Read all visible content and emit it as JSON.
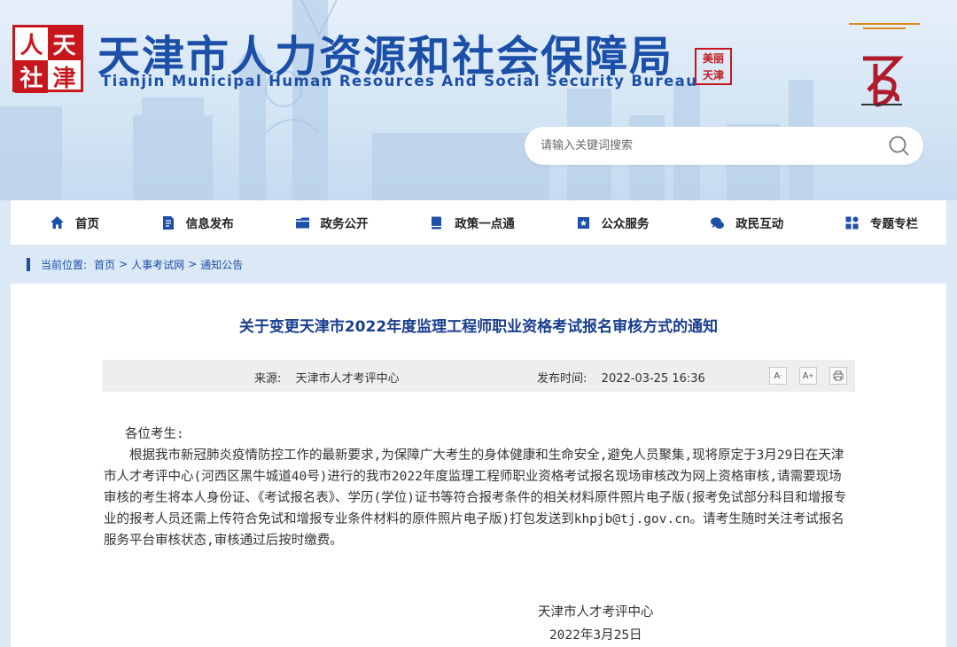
{
  "header": {
    "logo_chars": [
      "人",
      "天",
      "社",
      "津"
    ],
    "title": "天津市人力资源和社会保障局",
    "subtitle": "Tianjin Municipal Human Resources And Social Security Bureau",
    "seal_chars": [
      "美丽",
      "天津"
    ],
    "search_placeholder": "请输入关键词搜索"
  },
  "nav": {
    "items": [
      {
        "label": "首页",
        "icon": "home-icon"
      },
      {
        "label": "信息发布",
        "icon": "document-icon"
      },
      {
        "label": "政务公开",
        "icon": "folder-icon"
      },
      {
        "label": "政策一点通",
        "icon": "book-icon"
      },
      {
        "label": "公众服务",
        "icon": "service-icon"
      },
      {
        "label": "政民互动",
        "icon": "chat-icon"
      },
      {
        "label": "专题专栏",
        "icon": "grid-icon"
      }
    ]
  },
  "breadcrumb": {
    "prefix": "当前位置:",
    "items": [
      "首页",
      "人事考试网",
      "通知公告"
    ],
    "separator": ">"
  },
  "article": {
    "title": "关于变更天津市2022年度监理工程师职业资格考试报名审核方式的通知",
    "source_label": "来源:",
    "source": "天津市人才考评中心",
    "time_label": "发布时间:",
    "time": "2022-03-25 16:36",
    "font_decrease": "A",
    "font_increase": "A",
    "greeting": "各位考生:",
    "paragraph": "根据我市新冠肺炎疫情防控工作的最新要求,为保障广大考生的身体健康和生命安全,避免人员聚集,现将原定于3月29日在天津市人才考评中心(河西区黑牛城道40号)进行的我市2022年度监理工程师职业资格考试报名现场审核改为网上资格审核,请需要现场审核的考生将本人身份证、《考试报名表》、学历(学位)证书等符合报考条件的相关材料原件照片电子版(报考免试部分科目和增报专业的报考人员还需上传符合免试和增报专业条件材料的原件照片电子版)打包发送到khpjb@tj.gov.cn。请考生随时关注考试报名服务平台审核状态,审核通过后按时缴费。",
    "signature": "天津市人才考评中心",
    "date": "2022年3月25日"
  },
  "colors": {
    "brand_blue": "#1b4fa8",
    "red": "#c8161d",
    "background": "#dbe8f5"
  }
}
